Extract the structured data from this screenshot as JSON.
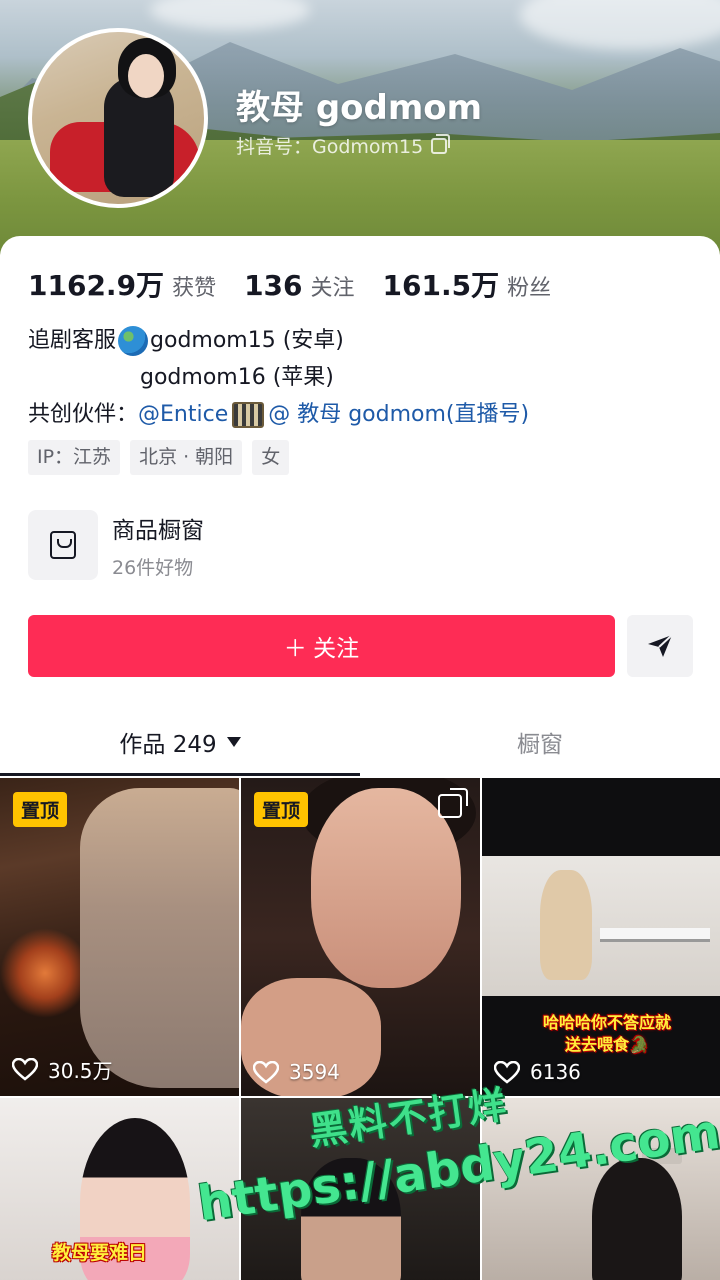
{
  "profile": {
    "name": "教母 godmom",
    "douyin_id_label": "抖音号：Godmom15"
  },
  "stats": [
    {
      "value": "1162.9万",
      "label": "获赞"
    },
    {
      "value": "136",
      "label": "关注"
    },
    {
      "value": "161.5万",
      "label": "粉丝"
    }
  ],
  "bio": {
    "line1_prefix": "追剧客服",
    "line1_account": "godmom15 (安卓)",
    "line2_account": "godmom16 (苹果)",
    "line3_prefix": "共创伙伴：",
    "line3_link1": "@Entice",
    "line3_link2": "@ 教母 godmom(直播号)"
  },
  "tags": [
    "IP：江苏",
    "北京 · 朝阳",
    "女"
  ],
  "shop": {
    "title": "商品橱窗",
    "subtitle": "26件好物"
  },
  "actions": {
    "follow_label": "＋ 关注"
  },
  "tabs": {
    "works_label": "作品 249",
    "showcase_label": "橱窗"
  },
  "videos": [
    {
      "pinned": "置顶",
      "likes": "30.5万"
    },
    {
      "pinned": "置顶",
      "likes": "3594"
    },
    {
      "caption": "哈哈哈你不答应就\n送去喂食🐊",
      "likes": "6136"
    },
    {
      "caption": "教母要难日"
    },
    {},
    {}
  ],
  "watermark": {
    "line1": "黑料不打烊",
    "line2": "https://abdy24.com"
  },
  "colors": {
    "accent": "#fe2c55",
    "pin_badge": "#ffc300",
    "link": "#1e5aa8",
    "watermark": "#44e690"
  }
}
